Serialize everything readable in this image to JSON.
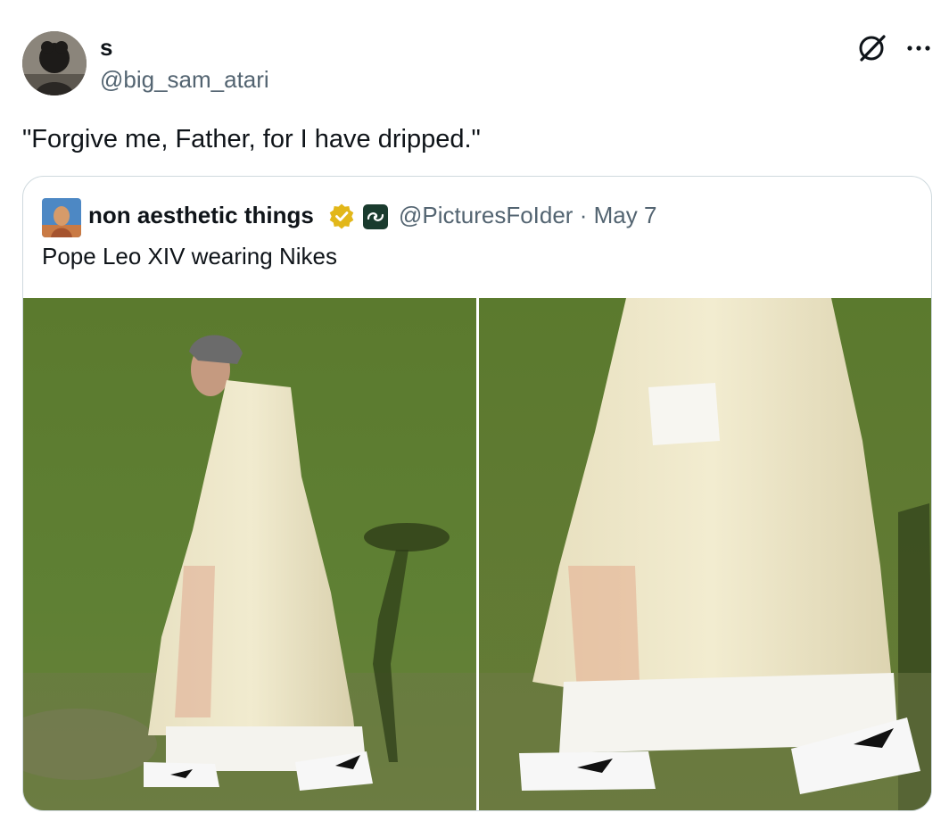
{
  "tweet": {
    "author": {
      "name": "s",
      "handle": "@big_sam_atari",
      "avatar_icon": "avatar-silhouette"
    },
    "text": "\"Forgive me, Father, for I have dripped.\"",
    "actions": {
      "grok": "grok-icon",
      "more": "more-icon"
    }
  },
  "quote": {
    "author": {
      "name": "non aesthetic things",
      "handle": "@PicturesFoIder",
      "verified": true,
      "verified_color": "#e2b719",
      "affiliate_badge": "affiliate-badge"
    },
    "date_separator": "·",
    "date": "May 7",
    "text": "Pope Leo XIV wearing Nikes",
    "media": [
      {
        "name": "photo-left",
        "description_icon": "photo-walking-priest"
      },
      {
        "name": "photo-right",
        "description_icon": "photo-vestment-closeup"
      }
    ]
  },
  "colors": {
    "text_primary": "#0f1419",
    "text_secondary": "#536471",
    "border": "#cfd9de",
    "grass": "#587a32"
  }
}
